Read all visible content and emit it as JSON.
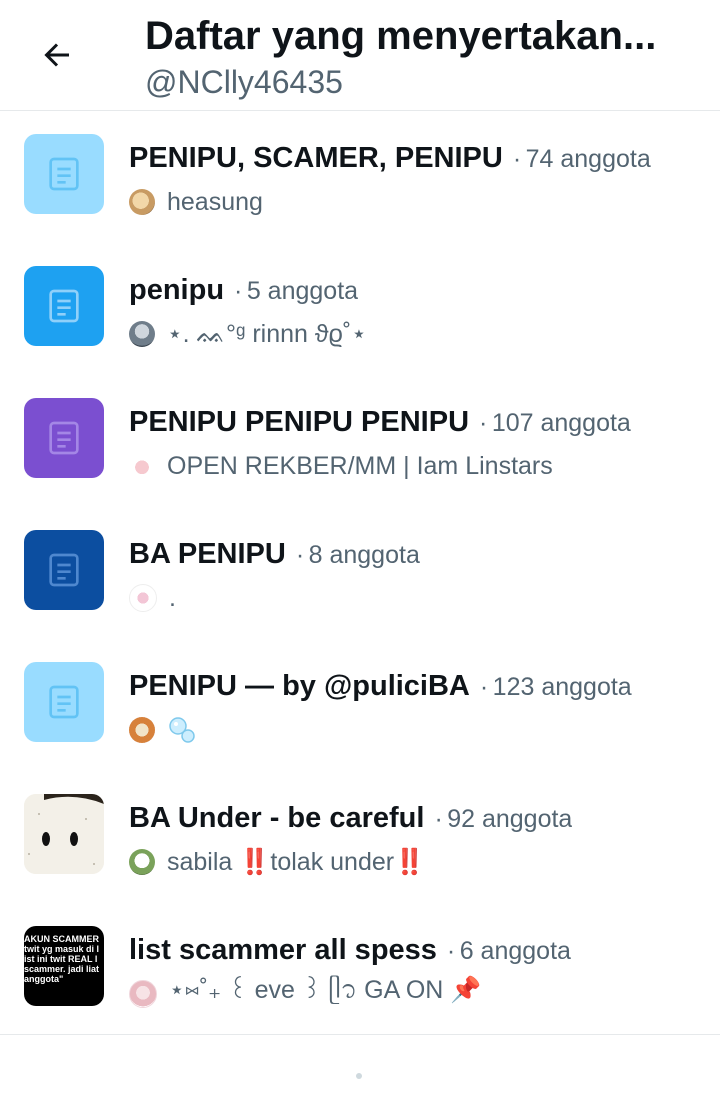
{
  "header": {
    "title": "Daftar yang menyertakan...",
    "handle": "@NClly46435",
    "back_icon": "arrow-left-icon"
  },
  "colors": {
    "text_primary": "#0f1419",
    "text_secondary": "#536471",
    "list_light_blue": "#8ed8ff",
    "list_blue": "#1d9bf0",
    "list_purple": "#7856ff",
    "list_navy": "#0f4c9e"
  },
  "lists": [
    {
      "name": "PENIPU, SCAMER, PENIPU",
      "separator": "·",
      "count": "74 anggota",
      "owner": "heasung",
      "thumb": "list-icon",
      "thumb_color": "#99dcff"
    },
    {
      "name": "penipu",
      "separator": "·",
      "count": "5 anggota",
      "owner": "⋆. ᨐ°ᵍ rinnn ϑϱ˚⋆",
      "thumb": "list-icon",
      "thumb_color": "#1ea1f1"
    },
    {
      "name": "PENIPU PENIPU PENIPU",
      "separator": "·",
      "count": "107 anggota",
      "owner": "OPEN REKBER/MM | Iam Linstars",
      "thumb": "list-icon",
      "thumb_color": "#7b4fd0"
    },
    {
      "name": "BA PENIPU",
      "separator": "·",
      "count": "8 anggota",
      "owner": ".",
      "thumb": "list-icon",
      "thumb_color": "#0c4ea0"
    },
    {
      "name": "PENIPU — by @puliciBA",
      "separator": "·",
      "count": "123 anggota",
      "owner": "",
      "thumb": "list-icon",
      "thumb_color": "#99dcff"
    },
    {
      "name": "BA Under - be careful",
      "separator": "·",
      "count": "92 anggota",
      "owner": "sabila ‼️tolak under‼️",
      "thumb": "photo",
      "thumb_color": "#f4f1ea"
    },
    {
      "name": "list scammer all spess",
      "separator": "·",
      "count": "6 anggota",
      "owner": "⋆⑅˚₊ ꒰ eve ꒱ ᥫ᭡ GA ON 📌",
      "thumb": "text-image",
      "thumb_color": "#000000",
      "thumb_text": [
        "AKUN SCAMMER",
        "twit yg masuk di l",
        "ist ini twit REAL l",
        "scammer. jadi liat",
        "anggota\""
      ]
    }
  ]
}
